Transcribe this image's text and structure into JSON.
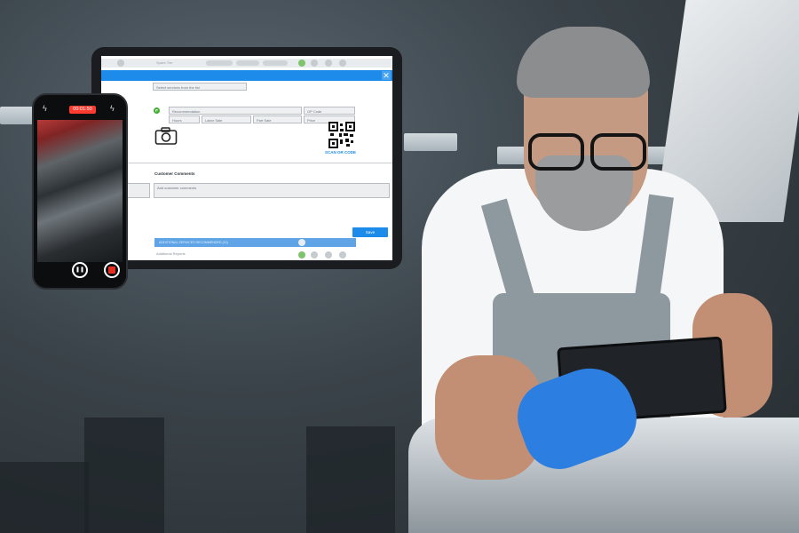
{
  "tablet": {
    "search_placeholder": "Select services from the list",
    "field_recommendation": "Recommendation",
    "field_op_code": "OP Code",
    "field_hours": "Hours",
    "field_labor_sale": "Labor Sale",
    "field_part_sale": "Part Sale",
    "field_price": "Price",
    "scan_label": "SCAN OR CODE",
    "customer_comments_label": "Customer Comments",
    "comments_placeholder": "Add customer comments",
    "save_label": "Save",
    "additional_strip": "ADDITIONAL SERVICES RECOMMENDED (10)",
    "additional_reports": "Additional Reports",
    "top_title": "Spare Tire"
  },
  "phone": {
    "record_time": "00:01:50",
    "left_icon": "flash-off-icon",
    "right_icon": "flash-icon"
  },
  "colors": {
    "accent": "#1d8be9",
    "record_red": "#ff3b30",
    "glove_blue": "#2c7ee0"
  }
}
